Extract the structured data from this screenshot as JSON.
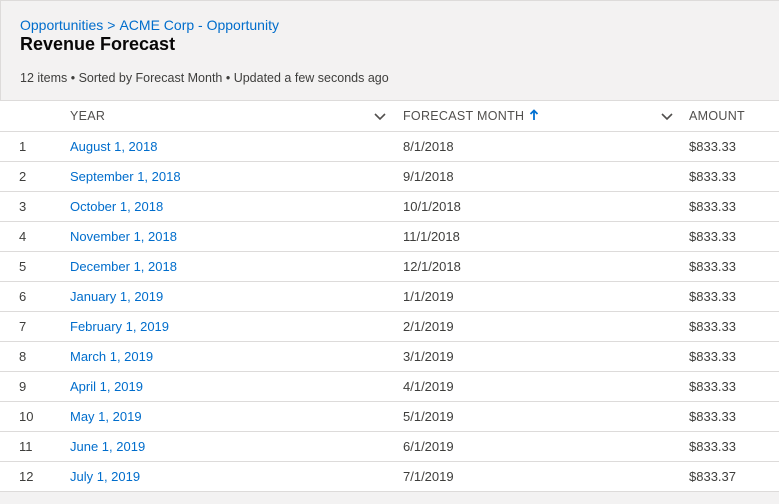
{
  "breadcrumb": {
    "items": [
      "Opportunities",
      "ACME Corp - Opportunity"
    ],
    "separator": ">"
  },
  "page_title": "Revenue Forecast",
  "status_line": "12 items • Sorted by Forecast Month • Updated a few seconds ago",
  "columns": {
    "year": "YEAR",
    "forecast_month": "FORECAST MONTH",
    "amount": "AMOUNT"
  },
  "rows": [
    {
      "num": "1",
      "year": "August 1, 2018",
      "month": "8/1/2018",
      "amount": "$833.33"
    },
    {
      "num": "2",
      "year": "September 1, 2018",
      "month": "9/1/2018",
      "amount": "$833.33"
    },
    {
      "num": "3",
      "year": "October 1, 2018",
      "month": "10/1/2018",
      "amount": "$833.33"
    },
    {
      "num": "4",
      "year": "November 1, 2018",
      "month": "11/1/2018",
      "amount": "$833.33"
    },
    {
      "num": "5",
      "year": "December 1, 2018",
      "month": "12/1/2018",
      "amount": "$833.33"
    },
    {
      "num": "6",
      "year": "January 1, 2019",
      "month": "1/1/2019",
      "amount": "$833.33"
    },
    {
      "num": "7",
      "year": "February 1, 2019",
      "month": "2/1/2019",
      "amount": "$833.33"
    },
    {
      "num": "8",
      "year": "March 1, 2019",
      "month": "3/1/2019",
      "amount": "$833.33"
    },
    {
      "num": "9",
      "year": "April 1, 2019",
      "month": "4/1/2019",
      "amount": "$833.33"
    },
    {
      "num": "10",
      "year": "May 1, 2019",
      "month": "5/1/2019",
      "amount": "$833.33"
    },
    {
      "num": "11",
      "year": "June 1, 2019",
      "month": "6/1/2019",
      "amount": "$833.33"
    },
    {
      "num": "12",
      "year": "July 1, 2019",
      "month": "7/1/2019",
      "amount": "$833.37"
    }
  ],
  "colors": {
    "link": "#006dcc",
    "header_bg": "#f3f2f2",
    "border": "#dddbda"
  },
  "icons": {
    "sort": "arrow-up-icon",
    "column_menu": "chevron-down-icon"
  }
}
